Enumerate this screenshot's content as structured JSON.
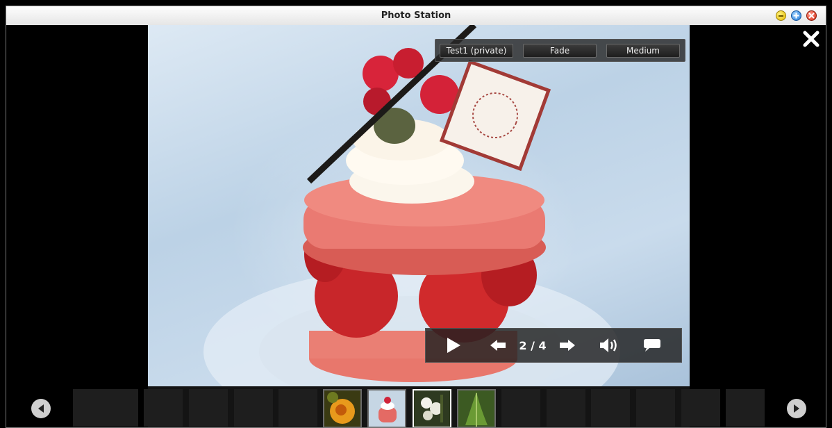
{
  "window": {
    "title": "Photo Station"
  },
  "settings": {
    "album": "Test1 (private)",
    "effect": "Fade",
    "speed": "Medium"
  },
  "controls": {
    "position_label": "2 / 4"
  },
  "thumbnails": [
    {
      "name": "orange-flower",
      "selected": false
    },
    {
      "name": "strawberry-dessert",
      "selected": false
    },
    {
      "name": "white-flowers",
      "selected": true
    },
    {
      "name": "green-plant",
      "selected": false
    }
  ],
  "colors": {
    "accent_min": "#e4b800",
    "accent_max": "#1f78d6",
    "accent_close": "#d62a12"
  }
}
